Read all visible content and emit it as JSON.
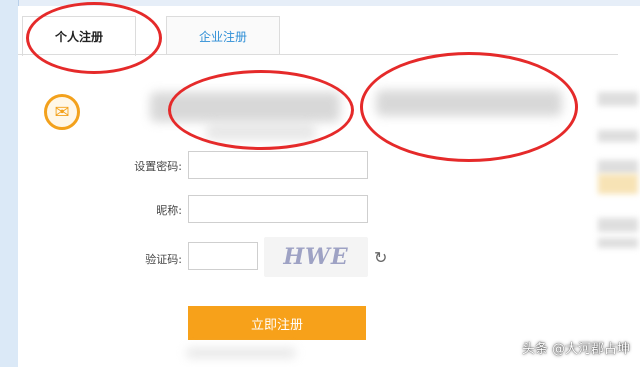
{
  "tabs": {
    "personal_label": "个人注册",
    "enterprise_label": "企业注册"
  },
  "form": {
    "password_label": "设置密码:",
    "nickname_label": "昵称:",
    "captcha_label": "验证码:",
    "password_value": "",
    "nickname_value": "",
    "captcha_value": "",
    "captcha_text": "HWE"
  },
  "submit_label": "立即注册",
  "watermark": "头条 @大河郡占坤",
  "icons": {
    "email": "email-icon",
    "refresh": "refresh-icon"
  },
  "colors": {
    "accent_orange": "#f7a11a",
    "tab_link_blue": "#2f8fd6",
    "annotation_red": "#e52a2a"
  }
}
